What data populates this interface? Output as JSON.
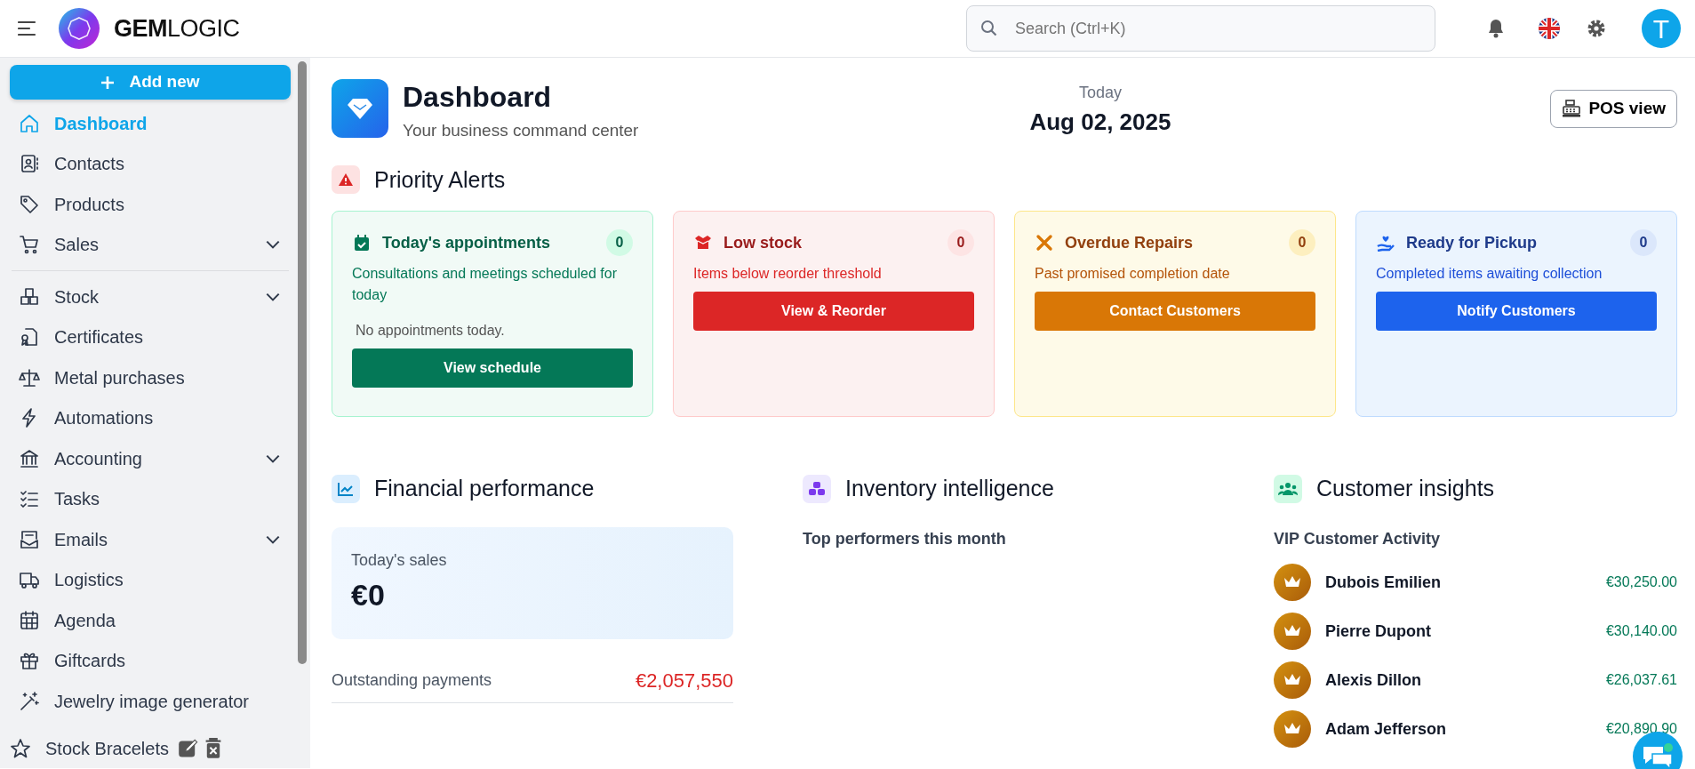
{
  "header": {
    "brand_first": "GEM",
    "brand_second": "LOGIC",
    "search": {
      "placeholder": "Search (Ctrl+K)"
    },
    "avatar": "T"
  },
  "sidebar": {
    "add_button": "Add new",
    "items": [
      {
        "label": "Dashboard",
        "selected": true,
        "expandable": false,
        "kind": "link"
      },
      {
        "label": "Contacts",
        "selected": false,
        "expandable": false,
        "kind": "link"
      },
      {
        "label": "Products",
        "selected": false,
        "expandable": false,
        "kind": "link"
      },
      {
        "label": "Sales",
        "selected": false,
        "expandable": true,
        "kind": "link"
      },
      {
        "label": "Stock",
        "selected": false,
        "expandable": true,
        "kind": "link"
      },
      {
        "label": "Certificates",
        "selected": false,
        "expandable": false,
        "kind": "link"
      },
      {
        "label": "Metal purchases",
        "selected": false,
        "expandable": false,
        "kind": "link"
      },
      {
        "label": "Automations",
        "selected": false,
        "expandable": false,
        "kind": "link"
      },
      {
        "label": "Accounting",
        "selected": false,
        "expandable": true,
        "kind": "link"
      },
      {
        "label": "Tasks",
        "selected": false,
        "expandable": false,
        "kind": "link"
      },
      {
        "label": "Emails",
        "selected": false,
        "expandable": true,
        "kind": "link"
      },
      {
        "label": "Logistics",
        "selected": false,
        "expandable": false,
        "kind": "link"
      },
      {
        "label": "Agenda",
        "selected": false,
        "expandable": false,
        "kind": "link"
      },
      {
        "label": "Giftcards",
        "selected": false,
        "expandable": false,
        "kind": "link"
      },
      {
        "label": "Jewelry image generator",
        "selected": false,
        "expandable": false,
        "kind": "link"
      },
      {
        "label": "Stock Bracelets",
        "selected": false,
        "expandable": false,
        "kind": "favorite"
      }
    ]
  },
  "page": {
    "title": "Dashboard",
    "subtitle": "Your business command center",
    "date_label": "Today",
    "date": "Aug 02, 2025",
    "pos_button": "POS view"
  },
  "alerts": {
    "title": "Priority Alerts",
    "cards": [
      {
        "title": "Today's appointments",
        "count": "0",
        "description": "Consultations and meetings scheduled for today",
        "note": "No appointments today.",
        "button": "View schedule",
        "kind": "success"
      },
      {
        "title": "Low stock",
        "count": "0",
        "description": "Items below reorder threshold",
        "button": "View & Reorder",
        "kind": "danger"
      },
      {
        "title": "Overdue Repairs",
        "count": "0",
        "description": "Past promised completion date",
        "button": "Contact Customers",
        "kind": "warning"
      },
      {
        "title": "Ready for Pickup",
        "count": "0",
        "description": "Completed items awaiting collection",
        "button": "Notify Customers",
        "kind": "primary"
      }
    ]
  },
  "financial": {
    "title": "Financial performance",
    "sales_label": "Today's sales",
    "sales_value": "€0",
    "outstanding_label": "Outstanding payments",
    "outstanding_value": "€2,057,550"
  },
  "inventory": {
    "title": "Inventory intelligence",
    "subtitle": "Top performers this month"
  },
  "customers": {
    "title": "Customer insights",
    "subtitle": "VIP Customer Activity",
    "vips": [
      {
        "name": "Dubois Emilien",
        "amount": "€30,250.00"
      },
      {
        "name": "Pierre Dupont",
        "amount": "€30,140.00"
      },
      {
        "name": "Alexis Dillon",
        "amount": "€26,037.61"
      },
      {
        "name": "Adam Jefferson",
        "amount": "€20,890.90"
      }
    ]
  }
}
